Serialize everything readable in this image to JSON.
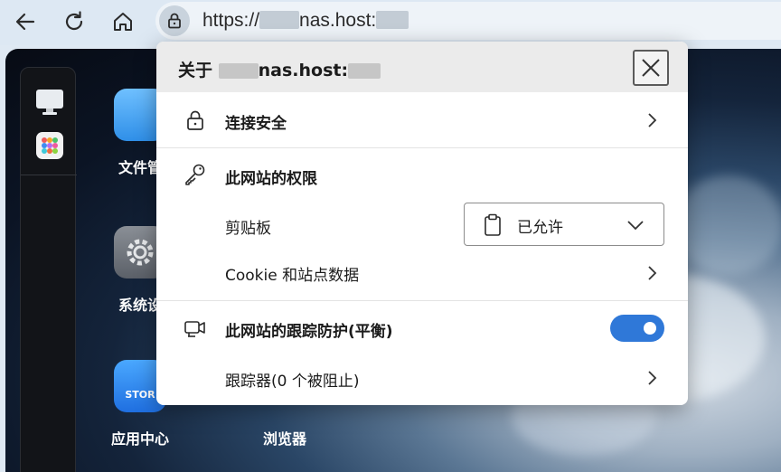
{
  "browser": {
    "url_prefix": "https://",
    "url_host": "nas.host:"
  },
  "desktop": {
    "apps": [
      {
        "label": "文件管"
      },
      {
        "label": "系统设"
      },
      {
        "label": "应用中心",
        "tile_text": "STOR"
      },
      {
        "label": "浏览器"
      }
    ]
  },
  "popup": {
    "title_prefix": "关于",
    "title_host": "nas.host:",
    "connection_label": "连接安全",
    "permissions_label": "此网站的权限",
    "clipboard_label": "剪贴板",
    "clipboard_value": "已允许",
    "cookie_label": "Cookie 和站点数据",
    "tracking_label": "此网站的跟踪防护(平衡)",
    "tracking_enabled": true,
    "trackers_label": "跟踪器(0 个被阻止)"
  },
  "colors": {
    "toggle_on": "#2f78d8",
    "header_bg": "#ebebeb",
    "toolbar_bg": "#dde8f3"
  }
}
